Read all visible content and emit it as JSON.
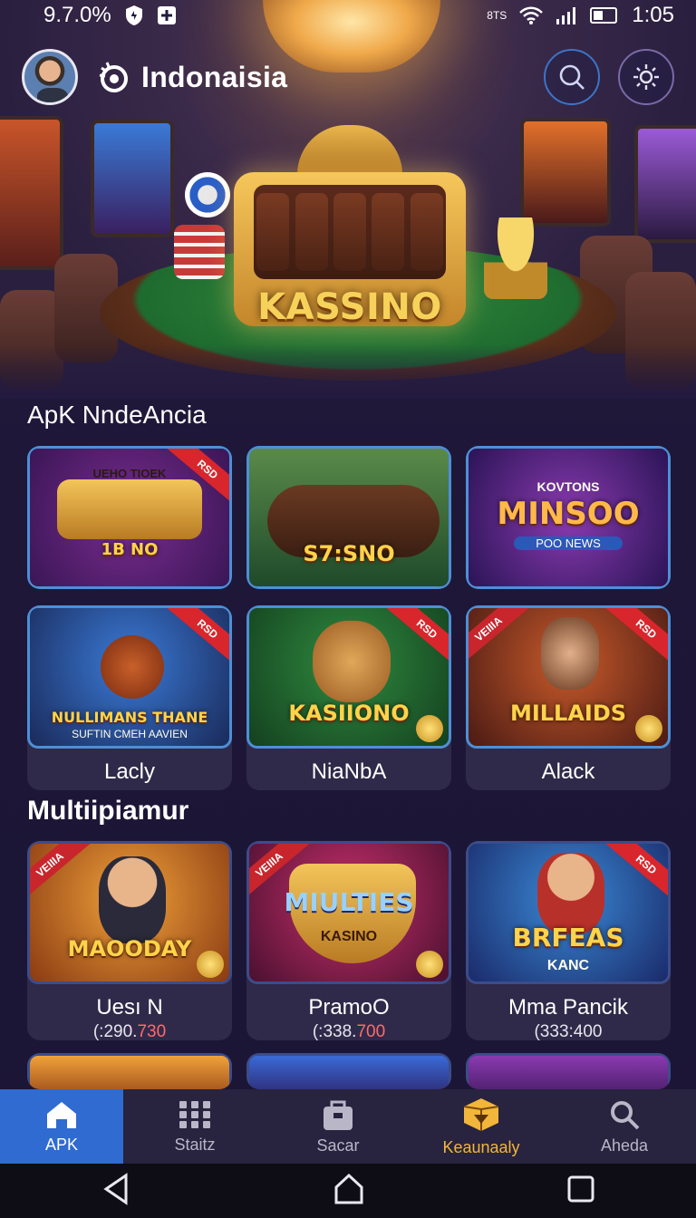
{
  "status_bar": {
    "battery_text": "9.7.0%",
    "signal_text": "8TS",
    "time": "1:05"
  },
  "header": {
    "title": "Indonaisia",
    "icons": [
      "avatar",
      "app-logo-icon",
      "search-icon",
      "settings-icon"
    ]
  },
  "hero": {
    "logo_text": "KASSINO"
  },
  "section1": {
    "title": "ApK NndeAncia",
    "cards": [
      {
        "art_title": "1B NO",
        "art_top": "UEHO TIOEK",
        "ribbon": "RSD",
        "label": ""
      },
      {
        "art_title": "S7:SNO",
        "ribbon": "",
        "label": ""
      },
      {
        "art_title": "MINSOO",
        "art_top": "KOVTONS",
        "art_sub": "POO NEWS",
        "ribbon": "",
        "label": ""
      },
      {
        "art_title": "NULLIMANS THANE",
        "art_sub": "SUFTIN CMEH AAVIEN",
        "ribbon": "RSD",
        "label": "Lacly"
      },
      {
        "art_title": "KASIIONO",
        "ribbon": "RSD",
        "label": "NiaNbA"
      },
      {
        "art_title": "MILLAIDS",
        "ribbon": "RSD",
        "ribbon_left": "VEIIIA",
        "label": "Alack"
      }
    ]
  },
  "section2": {
    "title": "Multiipiamur",
    "cards": [
      {
        "art_title": "MAOODAY",
        "ribbon_left": "VEIIIA",
        "label": "Uesı N",
        "sub_prefix": "(:290.",
        "sub_highlight": "730"
      },
      {
        "art_title": "MIULTIES",
        "art_sub": "KASINO",
        "ribbon_left": "VEIIIA",
        "label": "PramoO",
        "sub_prefix": "(:338.",
        "sub_highlight": "700"
      },
      {
        "art_title": "BRFEAS",
        "art_sub": "KANC",
        "ribbon": "RSD",
        "label": "Mma Pancik",
        "sub_prefix": "(333:400",
        "sub_highlight": ""
      }
    ]
  },
  "bottom_nav": {
    "items": [
      {
        "label": "APK",
        "icon": "home-icon",
        "active": true
      },
      {
        "label": "Staitz",
        "icon": "grid-icon",
        "active": false
      },
      {
        "label": "Sacar",
        "icon": "bag-icon",
        "active": false
      },
      {
        "label": "Keaunaaly",
        "icon": "box-icon",
        "active": false
      },
      {
        "label": "Aheda",
        "icon": "search-icon",
        "active": false
      }
    ]
  },
  "colors": {
    "background": "#1e1738",
    "accent_blue": "#2f6bd0",
    "gold": "#f2b63a",
    "ribbon_red": "#d8262c"
  }
}
